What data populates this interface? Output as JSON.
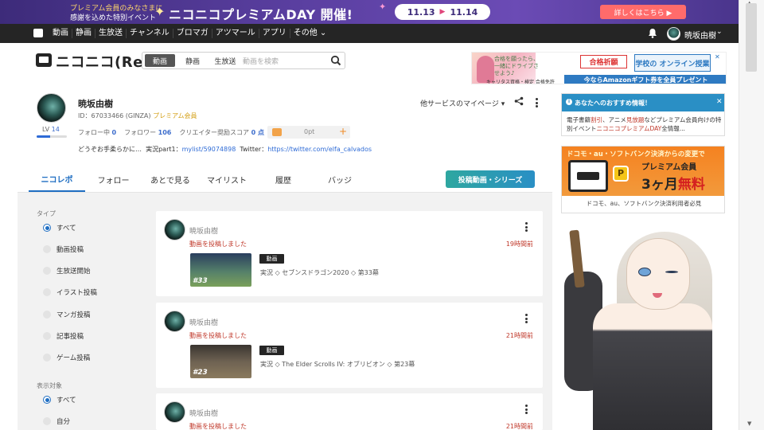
{
  "promo": {
    "line1": "プレミアム会員のみなさまに",
    "line2": "感謝を込めた特別イベント",
    "title": "ニコニコプレミアムDAY 開催!",
    "date_start": "11.13",
    "date_end": "11.14",
    "cta": "詳しくはこちら ▶"
  },
  "gnav": {
    "items": [
      "動画",
      "静画",
      "生放送",
      "チャンネル",
      "ブロマガ",
      "アツマール",
      "アプリ",
      "その他 ⌄"
    ],
    "user": "暁坂由樹"
  },
  "header": {
    "logo": "ニコニコ(Re)",
    "search_tabs": [
      "動画",
      "静画",
      "生放送"
    ],
    "search_placeholder": "動画を検索"
  },
  "ad_top": {
    "copy": "合格を願ったら、一緒にドライブさせよう♪",
    "maker": "キャリタス資格・検定 合格免許",
    "button1": "合格祈願",
    "button2": "学校の オンライン授業",
    "strip": "今ならAmazonギフト券を全員プレゼント"
  },
  "profile": {
    "name": "暁坂由樹",
    "id_text": "ID：67033466 (GINZA)",
    "premium": "プレミアム会員",
    "level_label": "LV",
    "level": "14",
    "level_progress": 0.45,
    "following_label": "フォロー中",
    "following": "0",
    "followers_label": "フォロワー",
    "followers": "106",
    "score_label": "クリエイター奨励スコア",
    "score": "0 点",
    "points": "0pt",
    "bio": "どうぞお手柔らかに…",
    "live_label": "実況part1：",
    "live_link": "mylist/59074898",
    "twitter_label": "Twitter：",
    "twitter_link": "https://twitter.com/elfa_calvados",
    "mypage": "他サービスのマイページ"
  },
  "tabs": [
    "ニコレポ",
    "フォロー",
    "あとで見る",
    "マイリスト",
    "履歴",
    "バッジ"
  ],
  "post_button": "投稿動画・シリーズ",
  "filters": {
    "type_title": "タイプ",
    "types": [
      "すべて",
      "動画投稿",
      "生放送開始",
      "イラスト投稿",
      "マンガ投稿",
      "記事投稿",
      "ゲーム投稿"
    ],
    "target_title": "表示対象",
    "targets": [
      "すべて",
      "自分"
    ]
  },
  "feed": [
    {
      "user": "暁坂由樹",
      "action": "動画を投稿しました",
      "time": "19時間前",
      "tag": "動画",
      "title": "実況 ◇ セブンスドラゴン2020 ◇ 第33幕",
      "thumb_text": "#33"
    },
    {
      "user": "暁坂由樹",
      "action": "動画を投稿しました",
      "time": "21時間前",
      "tag": "動画",
      "title": "実況 ◇ The Elder Scrolls IV: オブリビオン ◇ 第23幕",
      "thumb_text": "#23"
    },
    {
      "user": "暁坂由樹",
      "action": "動画を投稿しました",
      "time": "21時間前"
    }
  ],
  "reco": {
    "header": "あなたへのおすすめ情報！",
    "body_1": "電子書籍",
    "body_2": "割引",
    "body_3": "、アニメ",
    "body_4": "見放題",
    "body_5": "などプレミアム会員",
    "body_6": "向けの特別イベント",
    "body_7": "ニコニコプレミアムDAY",
    "body_8": "全情報..."
  },
  "ad_side": {
    "line1": "ドコモ・au・ソフトバンク決済",
    "line1b": "からの変更で",
    "premium": "プレミアム会員",
    "month": "3ヶ月",
    "free": "無料",
    "bottom": "ドコモ、au、ソフトバンク決済利用者必見"
  }
}
